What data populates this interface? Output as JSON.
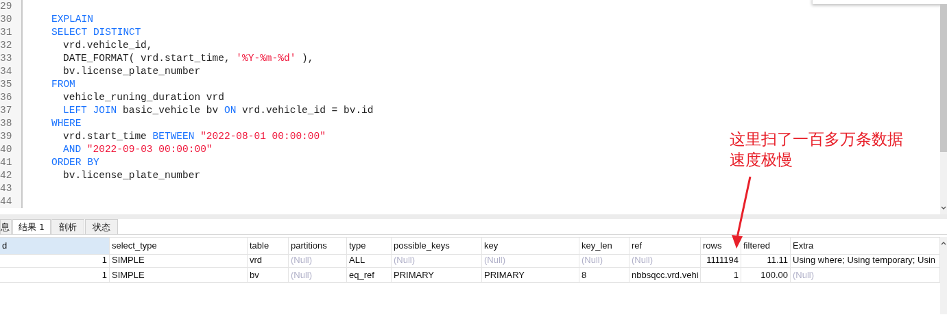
{
  "editor": {
    "lines": [
      {
        "number": "29"
      },
      {
        "number": "30",
        "indented": false,
        "segments": [
          {
            "kind": "keyword",
            "text": "EXPLAIN"
          }
        ]
      },
      {
        "number": "31",
        "indented": false,
        "segments": [
          {
            "kind": "keyword",
            "text": "SELECT DISTINCT"
          }
        ]
      },
      {
        "number": "32",
        "indented": true,
        "segments": [
          {
            "kind": "plain",
            "text": "vrd.vehicle_id,"
          }
        ]
      },
      {
        "number": "33",
        "indented": true,
        "segments": [
          {
            "kind": "plain",
            "text": "DATE_FORMAT( vrd.start_time, "
          },
          {
            "kind": "string",
            "text": "'%Y-%m-%d'"
          },
          {
            "kind": "plain",
            "text": " ),"
          }
        ]
      },
      {
        "number": "34",
        "indented": true,
        "segments": [
          {
            "kind": "plain",
            "text": "bv.license_plate_number"
          }
        ]
      },
      {
        "number": "35",
        "indented": false,
        "segments": [
          {
            "kind": "keyword",
            "text": "FROM"
          }
        ]
      },
      {
        "number": "36",
        "indented": true,
        "segments": [
          {
            "kind": "plain",
            "text": "vehicle_runing_duration vrd"
          }
        ]
      },
      {
        "number": "37",
        "indented": true,
        "segments": [
          {
            "kind": "keyword",
            "text": "LEFT JOIN"
          },
          {
            "kind": "plain",
            "text": " basic_vehicle bv "
          },
          {
            "kind": "keyword",
            "text": "ON"
          },
          {
            "kind": "plain",
            "text": " vrd.vehicle_id = bv.id"
          }
        ]
      },
      {
        "number": "38",
        "indented": false,
        "segments": [
          {
            "kind": "keyword",
            "text": "WHERE"
          }
        ]
      },
      {
        "number": "39",
        "indented": true,
        "segments": [
          {
            "kind": "plain",
            "text": "vrd.start_time "
          },
          {
            "kind": "keyword",
            "text": "BETWEEN "
          },
          {
            "kind": "string",
            "text": "\"2022-08-01 00:00:00\""
          }
        ]
      },
      {
        "number": "40",
        "indented": true,
        "segments": [
          {
            "kind": "keyword",
            "text": "AND "
          },
          {
            "kind": "string",
            "text": "\"2022-09-03 00:00:00\""
          }
        ]
      },
      {
        "number": "41",
        "indented": false,
        "segments": [
          {
            "kind": "keyword",
            "text": "ORDER BY"
          }
        ]
      },
      {
        "number": "42",
        "indented": true,
        "segments": [
          {
            "kind": "plain",
            "text": "bv.license_plate_number"
          }
        ]
      },
      {
        "number": "43"
      },
      {
        "number": "44"
      }
    ]
  },
  "annotation": {
    "lines": [
      "这里扫了一百多万条数据",
      "速度极慢"
    ]
  },
  "tabs": [
    {
      "label": "息",
      "selected": false
    },
    {
      "label": "结果 1",
      "selected": true
    },
    {
      "label": "剖析",
      "selected": false
    },
    {
      "label": "状态",
      "selected": false
    }
  ],
  "grid": {
    "columns": [
      {
        "label": "d",
        "selected": true,
        "numeric": true
      },
      {
        "label": "select_type",
        "selected": false,
        "numeric": false
      },
      {
        "label": "table",
        "selected": false,
        "numeric": false
      },
      {
        "label": "partitions",
        "selected": false,
        "numeric": false
      },
      {
        "label": "type",
        "selected": false,
        "numeric": false
      },
      {
        "label": "possible_keys",
        "selected": false,
        "numeric": false
      },
      {
        "label": "key",
        "selected": false,
        "numeric": false
      },
      {
        "label": "key_len",
        "selected": false,
        "numeric": false
      },
      {
        "label": "ref",
        "selected": false,
        "numeric": false
      },
      {
        "label": "rows",
        "selected": false,
        "numeric": true
      },
      {
        "label": "filtered",
        "selected": false,
        "numeric": true
      },
      {
        "label": "Extra",
        "selected": false,
        "numeric": false
      }
    ],
    "rows": [
      [
        {
          "text": "1",
          "null": false
        },
        {
          "text": "SIMPLE",
          "null": false
        },
        {
          "text": "vrd",
          "null": false
        },
        {
          "text": "(Null)",
          "null": true
        },
        {
          "text": "ALL",
          "null": false
        },
        {
          "text": "(Null)",
          "null": true
        },
        {
          "text": "(Null)",
          "null": true
        },
        {
          "text": "(Null)",
          "null": true
        },
        {
          "text": "(Null)",
          "null": true
        },
        {
          "text": "1111194",
          "null": false
        },
        {
          "text": "11.11",
          "null": false
        },
        {
          "text": "Using where; Using temporary; Usin",
          "null": false
        }
      ],
      [
        {
          "text": "1",
          "null": false
        },
        {
          "text": "SIMPLE",
          "null": false
        },
        {
          "text": "bv",
          "null": false
        },
        {
          "text": "(Null)",
          "null": true
        },
        {
          "text": "eq_ref",
          "null": false
        },
        {
          "text": "PRIMARY",
          "null": false
        },
        {
          "text": "PRIMARY",
          "null": false
        },
        {
          "text": "8",
          "null": false
        },
        {
          "text": "nbbsqcc.vrd.vehi",
          "null": false
        },
        {
          "text": "1",
          "null": false
        },
        {
          "text": "100.00",
          "null": false
        },
        {
          "text": "(Null)",
          "null": true
        }
      ]
    ]
  }
}
